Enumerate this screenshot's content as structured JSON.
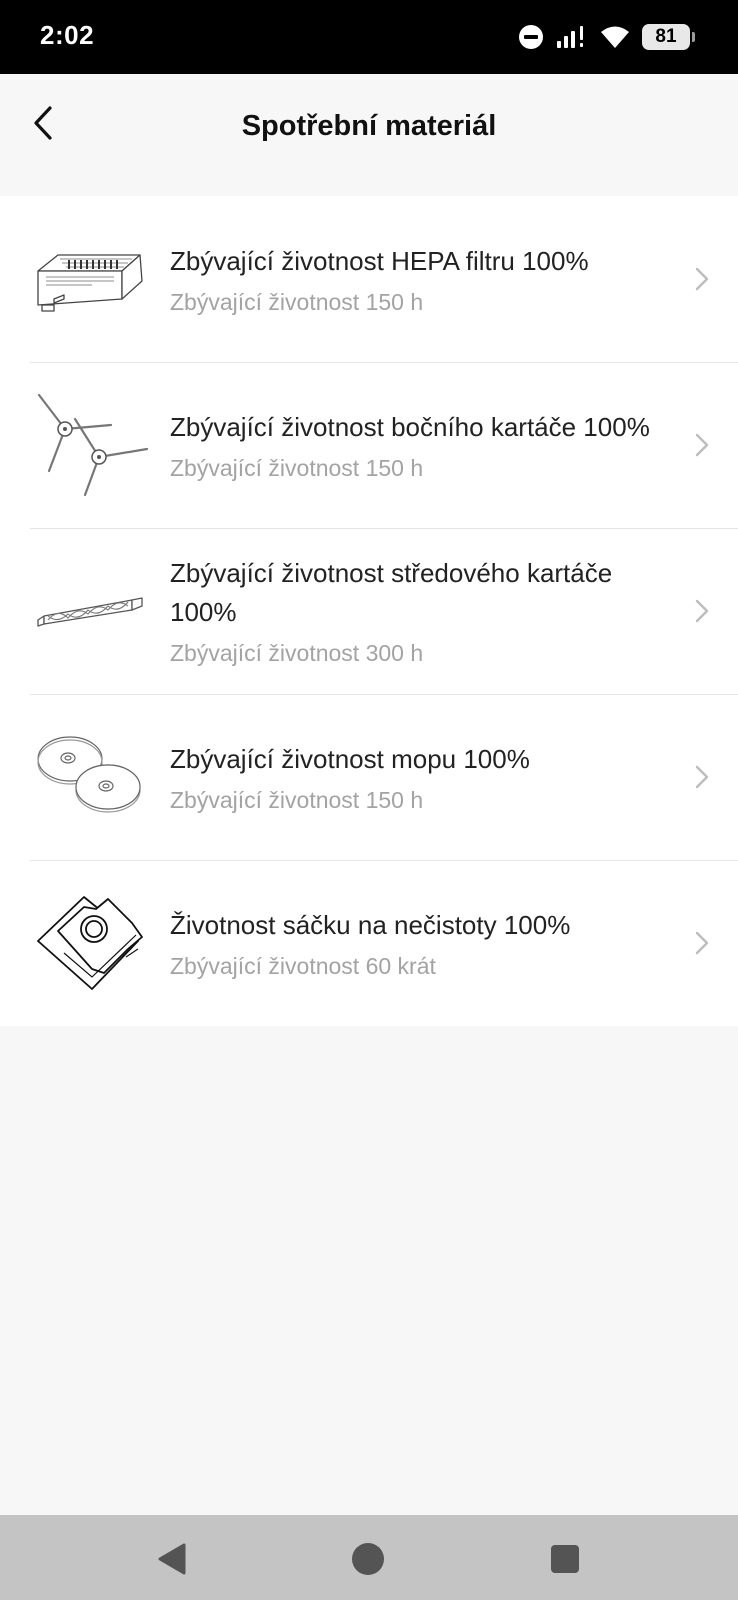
{
  "status_bar": {
    "time": "2:02",
    "battery": "81",
    "icons": [
      "do-not-disturb-icon",
      "signal-icon",
      "wifi-icon",
      "battery-icon"
    ]
  },
  "header": {
    "title": "Spotřební materiál",
    "back_icon": "chevron-left-icon"
  },
  "consumables": [
    {
      "icon": "hepa-filter-icon",
      "title": "Zbývající životnost HEPA filtru 100%",
      "subtitle": "Zbývající životnost 150 h"
    },
    {
      "icon": "side-brush-icon",
      "title": "Zbývající životnost bočního kartáče 100%",
      "subtitle": "Zbývající životnost 150 h"
    },
    {
      "icon": "main-brush-icon",
      "title": "Zbývající životnost středového kartáče 100%",
      "subtitle": "Zbývající životnost 300 h"
    },
    {
      "icon": "mop-pads-icon",
      "title": "Zbývající životnost mopu 100%",
      "subtitle": "Zbývající životnost 150 h"
    },
    {
      "icon": "dust-bag-icon",
      "title": "Životnost sáčku na nečistoty 100%",
      "subtitle": "Zbývající životnost 60 krát"
    }
  ],
  "nav_bar": {
    "icons": [
      "back-triangle-icon",
      "home-circle-icon",
      "recents-square-icon"
    ]
  }
}
